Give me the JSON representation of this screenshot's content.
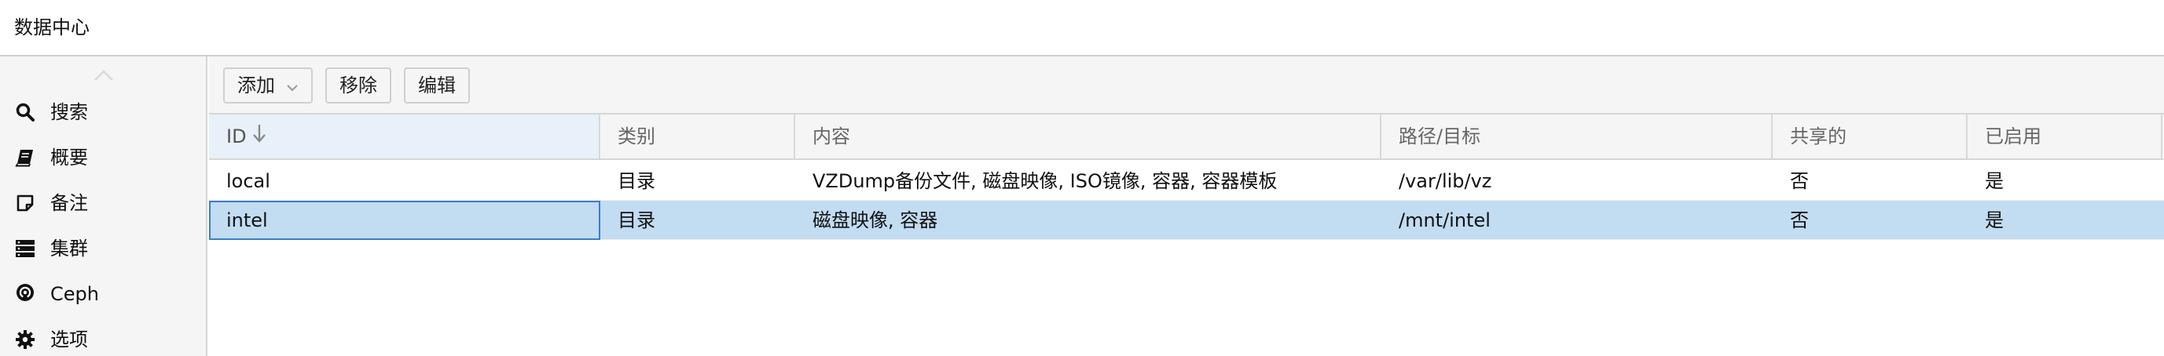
{
  "titlebar": {
    "title": "数据中心"
  },
  "sidebar": {
    "items": [
      {
        "label": "搜索",
        "icon": "search-icon"
      },
      {
        "label": "概要",
        "icon": "book-icon"
      },
      {
        "label": "备注",
        "icon": "note-icon"
      },
      {
        "label": "集群",
        "icon": "server-icon"
      },
      {
        "label": "Ceph",
        "icon": "ceph-icon"
      },
      {
        "label": "选项",
        "icon": "gear-icon"
      }
    ]
  },
  "toolbar": {
    "add_label": "添加",
    "remove_label": "移除",
    "edit_label": "编辑"
  },
  "grid": {
    "columns": [
      "ID",
      "类别",
      "内容",
      "路径/目标",
      "共享的",
      "已启用"
    ],
    "sorted_column": "ID",
    "sort_direction": "descending",
    "rows": [
      {
        "id": "local",
        "type": "目录",
        "content": "VZDump备份文件, 磁盘映像, ISO镜像, 容器, 容器模板",
        "path": "/var/lib/vz",
        "shared": "否",
        "enabled": "是",
        "selected": false
      },
      {
        "id": "intel",
        "type": "目录",
        "content": "磁盘映像, 容器",
        "path": "/mnt/intel",
        "shared": "否",
        "enabled": "是",
        "selected": true
      }
    ]
  },
  "colors": {
    "selected_row": "#c2dcf2",
    "sorted_header": "#e8f1fa",
    "focus_border": "#3a7fc8"
  }
}
